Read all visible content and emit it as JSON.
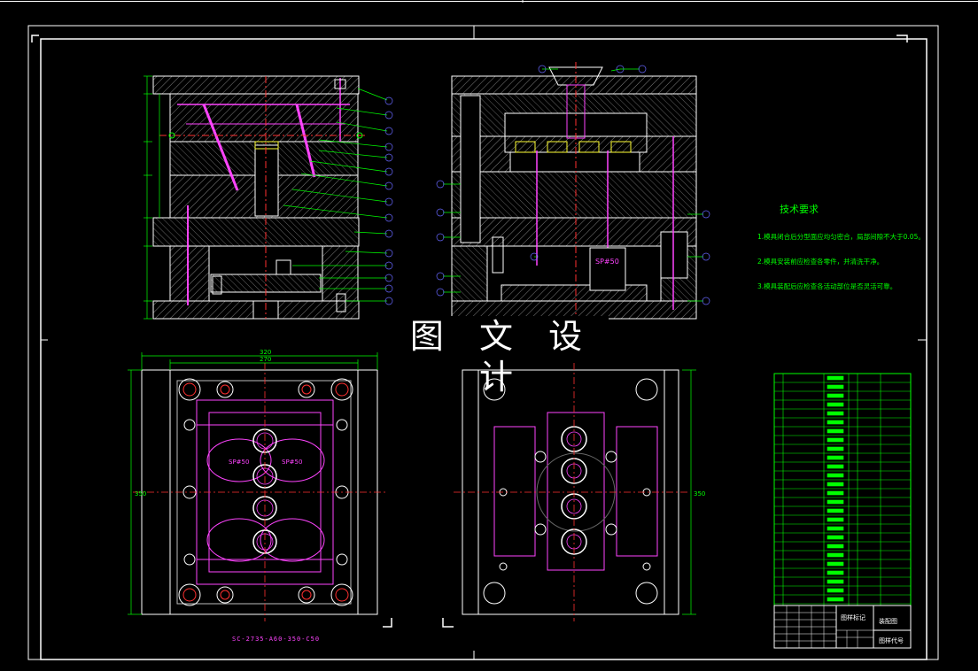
{
  "watermark": "图 文 设 计",
  "technical_requirements": {
    "title": "技术要求",
    "lines": [
      "1.模具闭合后分型面应均匀密合，局部间隙不大于0.05。",
      "2.模具安装前应检查各零件，并清洗干净。",
      "3.模具装配后应检查各活动部位是否灵活可靠。"
    ]
  },
  "view_labels": {
    "sprue": "SP#50",
    "cavity_a": "SP#50",
    "cavity_b": "SP#50"
  },
  "dimensions": {
    "top_width": "320",
    "inner_width": "270",
    "height_left": "350",
    "height_right": "350"
  },
  "drawing_code": "SC-2735-A60-350-C50",
  "title_block": {
    "company": "图样标记",
    "name": "装配图",
    "code": "图样代号"
  },
  "colors": {
    "outline": "#ffffff",
    "hatch": "#ffffff",
    "green": "#00ff00",
    "magenta": "#ff44ff",
    "red": "#ff3030",
    "yellow": "#ffff33",
    "cyan": "#33ffff",
    "blue": "#6666ff"
  }
}
